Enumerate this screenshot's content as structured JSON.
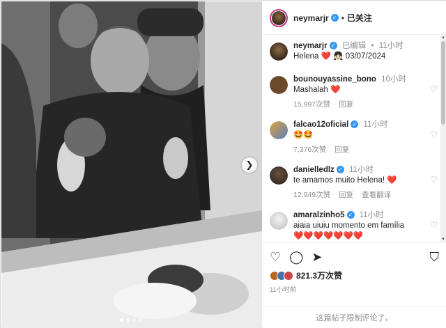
{
  "post": {
    "author": "neymarjr",
    "follow_state": "已关注",
    "separator": "•"
  },
  "photo": {
    "next_icon": "chevron-right-icon",
    "next_glyph": "❯",
    "total_slides": 4,
    "active_slide": 1
  },
  "caption": {
    "user": "neymarjr",
    "edited": "已编辑",
    "separator": "•",
    "time": "11小时",
    "text_prefix": "Helena ",
    "emoji_heart": "❤️",
    "emoji_girl": "👧🏻",
    "text_date": " 03/07/2024"
  },
  "comments": [
    {
      "user": "bounouyassine_bono",
      "verified": false,
      "time": "10小时",
      "text": "Mashalah ",
      "emoji": "❤️",
      "likes": "15,997次赞",
      "reply": "回复",
      "translate": "",
      "avatar_color": "#6b4a2b"
    },
    {
      "user": "falcao12oficial",
      "verified": true,
      "time": "11小时",
      "text": "",
      "emoji": "🤩🤩",
      "likes": "7,376次赞",
      "reply": "回复",
      "translate": "",
      "avatar_color": "#d9a441"
    },
    {
      "user": "danielledlz",
      "verified": true,
      "time": "11小时",
      "text": "te amamos muito Helena! ",
      "emoji": "❤️",
      "likes": "12,949次赞",
      "reply": "回复",
      "translate": "查看翻译",
      "avatar_color": "#3b2f2f"
    },
    {
      "user": "amaralzinho5",
      "verified": true,
      "time": "11小时",
      "text": "aiaia uiuiu momento em família ",
      "emoji": "❤️❤️❤️❤️❤️❤️❤️",
      "likes": "",
      "reply": "",
      "translate": "",
      "avatar_color": "#e0e0e0"
    }
  ],
  "actions": {
    "like_icon": "heart-outline-icon",
    "comment_icon": "comment-icon",
    "share_icon": "share-icon",
    "save_icon": "bookmark-icon",
    "like_glyph": "♡",
    "comment_glyph": "◯",
    "share_glyph": "➤",
    "save_glyph": "⛉"
  },
  "likes": {
    "count": "821.3万次赞",
    "liker_avatar_colors": [
      "#b5651d",
      "#4a6fa5",
      "#c44"
    ]
  },
  "post_time": "11小时前",
  "comments_footer": "这篇帖子限制评论了。",
  "colors": {
    "verified_blue": "#3897f0",
    "heart_red": "#ed4956",
    "muted_gray": "#8e8e8e",
    "story_ring": "#c13584"
  }
}
